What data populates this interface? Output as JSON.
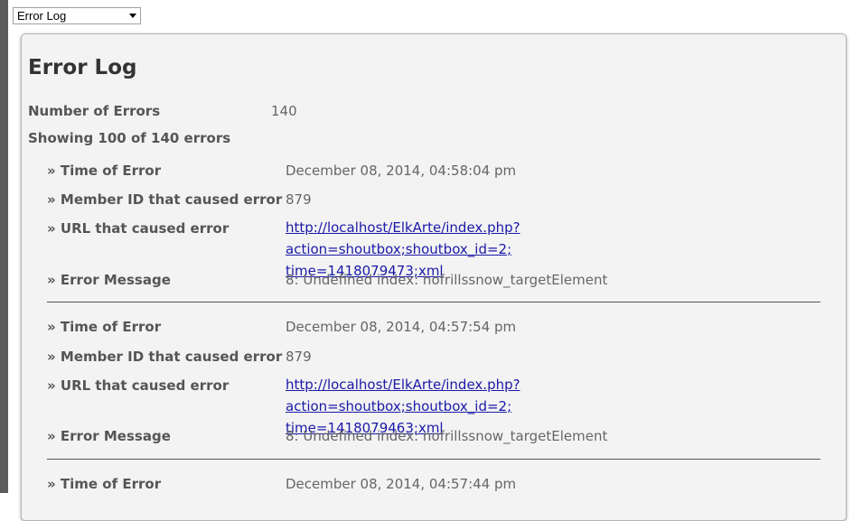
{
  "selector": {
    "selected": "Error Log"
  },
  "panel": {
    "title": "Error Log",
    "count_label": "Number of Errors",
    "count_value": "140",
    "showing": "Showing 100 of 140 errors"
  },
  "labels": {
    "time": "» Time of Error",
    "member": "» Member ID that caused error",
    "url": "» URL that caused error",
    "message": "» Error Message"
  },
  "errors": [
    {
      "time": "December 08, 2014, 04:58:04 pm",
      "member": "879",
      "url_line1": "http://localhost/ElkArte/index.php?action=shoutbox;shoutbox_id=2;",
      "url_line2": "time=1418079473;xml",
      "message": "8: Undefined index: nofrillssnow_targetElement"
    },
    {
      "time": "December 08, 2014, 04:57:54 pm",
      "member": "879",
      "url_line1": "http://localhost/ElkArte/index.php?action=shoutbox;shoutbox_id=2;",
      "url_line2": "time=1418079463;xml",
      "message": "8: Undefined index: nofrillssnow_targetElement"
    },
    {
      "time": "December 08, 2014, 04:57:44 pm"
    }
  ],
  "colors": {
    "link": "#1a1aa8",
    "panel_bg": "#f3f3f3",
    "left_edge": "#5c5c5c"
  }
}
